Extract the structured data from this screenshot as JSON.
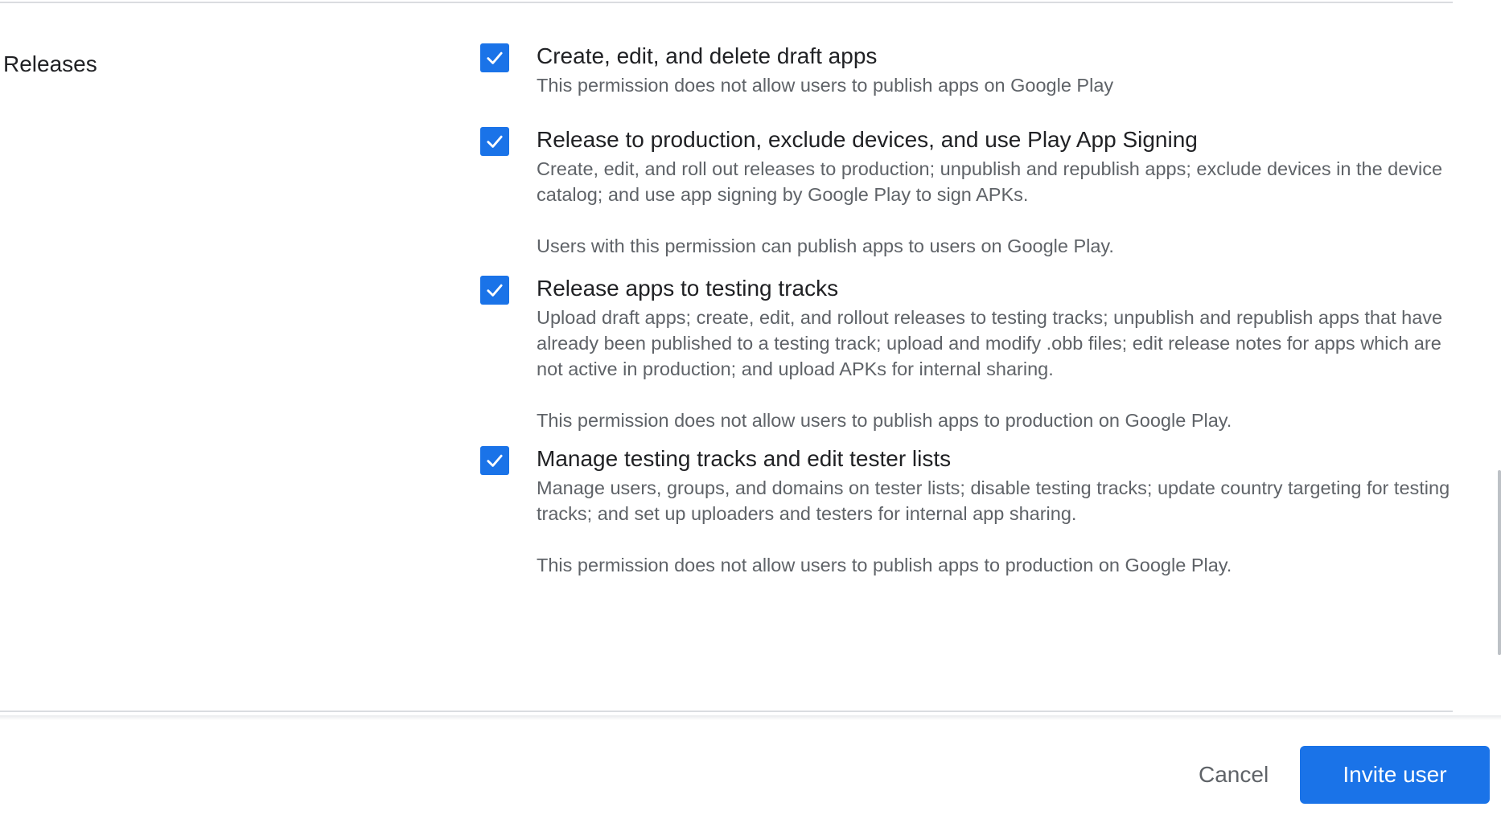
{
  "section": {
    "label": "Releases"
  },
  "permissions": [
    {
      "title": "Create, edit, and delete draft apps",
      "description": "This permission does not allow users to publish apps on Google Play",
      "note": "",
      "checked": true
    },
    {
      "title": "Release to production, exclude devices, and use Play App Signing",
      "description": "Create, edit, and roll out releases to production; unpublish and republish apps; exclude devices in the device catalog; and use app signing by Google Play to sign APKs.",
      "note": "Users with this permission can publish apps to users on Google Play.",
      "checked": true
    },
    {
      "title": "Release apps to testing tracks",
      "description": "Upload draft apps; create, edit, and rollout releases to testing tracks; unpublish and republish apps that have already been published to a testing track; upload and modify .obb files; edit release notes for apps which are not active in production; and upload APKs for internal sharing.",
      "note": "This permission does not allow users to publish apps to production on Google Play.",
      "checked": true
    },
    {
      "title": "Manage testing tracks and edit tester lists",
      "description": "Manage users, groups, and domains on tester lists; disable testing tracks; update country targeting for testing tracks; and set up uploaders and testers for internal app sharing.",
      "note": "This permission does not allow users to publish apps to production on Google Play.",
      "checked": true
    }
  ],
  "footer": {
    "cancel_label": "Cancel",
    "invite_label": "Invite user"
  },
  "icons": {
    "checkbox": "check-icon"
  },
  "colors": {
    "accent": "#1a73e8",
    "text_primary": "#202124",
    "text_secondary": "#5f6368",
    "divider": "#dadce0"
  }
}
